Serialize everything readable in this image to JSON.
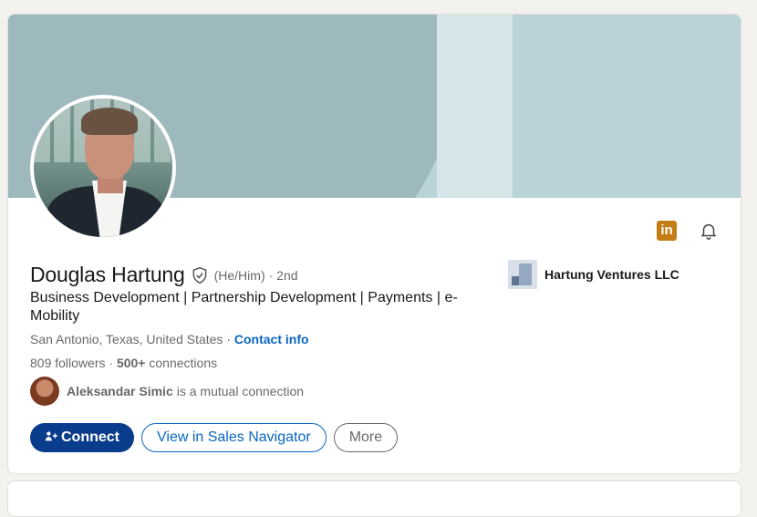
{
  "profile": {
    "name": "Douglas Hartung",
    "pronouns": "(He/Him)",
    "degree": "· 2nd",
    "headline": "Business Development | Partnership Development | Payments | e-Mobility",
    "location": "San Antonio, Texas, United States",
    "location_separator": " · ",
    "contact_label": "Contact info",
    "followers": "809 followers",
    "stats_separator": " · ",
    "connections_count": "500+",
    "connections_label": " connections",
    "mutual_name": "Aleksandar Simic",
    "mutual_text": "is a mutual connection"
  },
  "company": {
    "name": "Hartung Ventures LLC"
  },
  "actions": {
    "connect_label": "Connect",
    "sales_navigator_label": "View in Sales Navigator",
    "more_label": "More"
  },
  "icons": {
    "linkedin_badge": "in",
    "verified": "shield-check-icon",
    "bell": "bell-icon",
    "connect": "add-person-icon"
  },
  "colors": {
    "accent": "#0a66c2",
    "primary_button": "#0a3c8c",
    "linkedin_badge": "#c37d16",
    "banner": "#b9d3d9"
  }
}
